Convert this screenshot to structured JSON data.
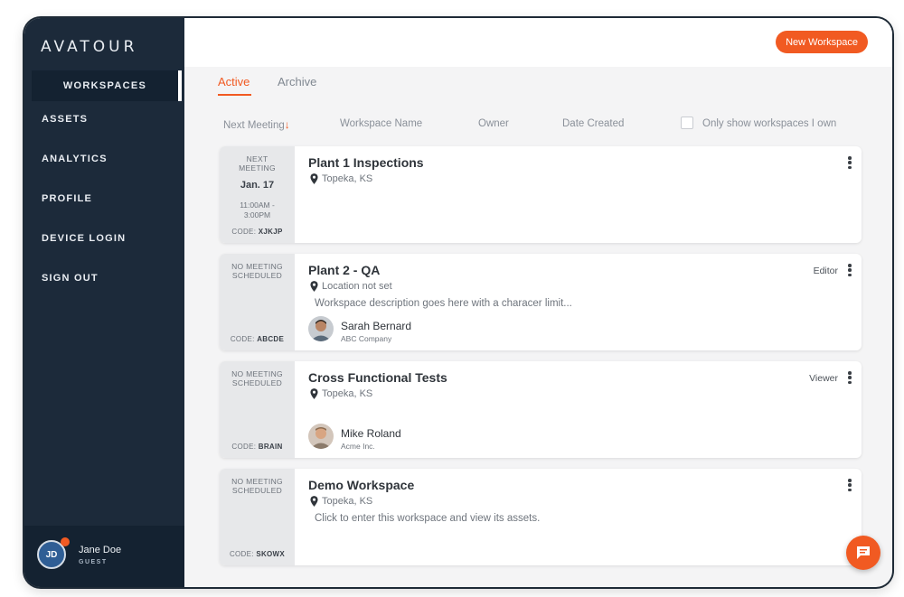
{
  "sidebar": {
    "logo": "AVATOUR",
    "active_item": "WORKSPACES",
    "items": [
      "ASSETS",
      "ANALYTICS",
      "PROFILE",
      "DEVICE LOGIN",
      "SIGN OUT"
    ],
    "user": {
      "initials": "JD",
      "name": "Jane Doe",
      "role": "GUEST"
    }
  },
  "header": {
    "new_workspace_label": "New Workspace"
  },
  "tabs": {
    "active": "Active",
    "archive": "Archive"
  },
  "columns": {
    "next_meeting": "Next Meeting",
    "sort_arrow": "↓",
    "workspace_name": "Workspace Name",
    "owner": "Owner",
    "date_created": "Date Created",
    "only_mine": "Only show workspaces I own"
  },
  "workspaces": [
    {
      "meeting_label_1": "NEXT",
      "meeting_label_2": "MEETING",
      "date": "Jan. 17",
      "time_1": "11:00AM -",
      "time_2": "3:00PM",
      "code_label": "CODE:",
      "code": "XJKJP",
      "title": "Plant 1 Inspections",
      "location": "Topeka, KS"
    },
    {
      "meeting_label_1": "NO MEETING",
      "meeting_label_2": "SCHEDULED",
      "code_label": "CODE:",
      "code": "ABCDE",
      "title": "Plant 2 - QA",
      "location": "Location not set",
      "description": "Workspace description goes here with a characer limit...",
      "role": "Editor",
      "owner_name": "Sarah Bernard",
      "owner_company": "ABC Company"
    },
    {
      "meeting_label_1": "NO MEETING",
      "meeting_label_2": "SCHEDULED",
      "code_label": "CODE:",
      "code": "BRAIN",
      "title": "Cross Functional Tests",
      "location": "Topeka, KS",
      "role": "Viewer",
      "owner_name": "Mike Roland",
      "owner_company": "Acme Inc."
    },
    {
      "meeting_label_1": "NO MEETING",
      "meeting_label_2": "SCHEDULED",
      "code_label": "CODE:",
      "code": "SKOWX",
      "title": "Demo Workspace",
      "location": "Topeka, KS",
      "description": "Click to enter this workspace and view its assets."
    }
  ],
  "colors": {
    "accent": "#f15a22",
    "sidebar": "#1c2a3a",
    "sidebar_dark": "#142231"
  },
  "icons": {
    "pin": "map-pin-icon",
    "kebab": "kebab-menu-icon",
    "chat": "chat-bubble-icon"
  }
}
